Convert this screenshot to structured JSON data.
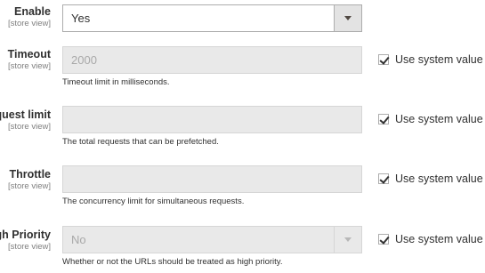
{
  "rows": [
    {
      "label": "Enable",
      "scope": "[store view]",
      "value": "Yes",
      "note": "",
      "use_system_value": ""
    },
    {
      "label": "Timeout",
      "scope": "[store view]",
      "value": "2000",
      "note": "Timeout limit in milliseconds.",
      "use_system_value": "Use system value"
    },
    {
      "label": "quest limit",
      "scope": "[store view]",
      "value": "",
      "note": "The total requests that can be prefetched.",
      "use_system_value": "Use system value"
    },
    {
      "label": "Throttle",
      "scope": "[store view]",
      "value": "",
      "note": "The concurrency limit for simultaneous requests.",
      "use_system_value": "Use system value"
    },
    {
      "label": "gh Priority",
      "scope": "[store view]",
      "value": "No",
      "note": "Whether or not the URLs should be treated as high priority.",
      "use_system_value": "Use system value"
    }
  ],
  "checkboxes_checked": [
    true,
    true,
    true,
    true
  ]
}
